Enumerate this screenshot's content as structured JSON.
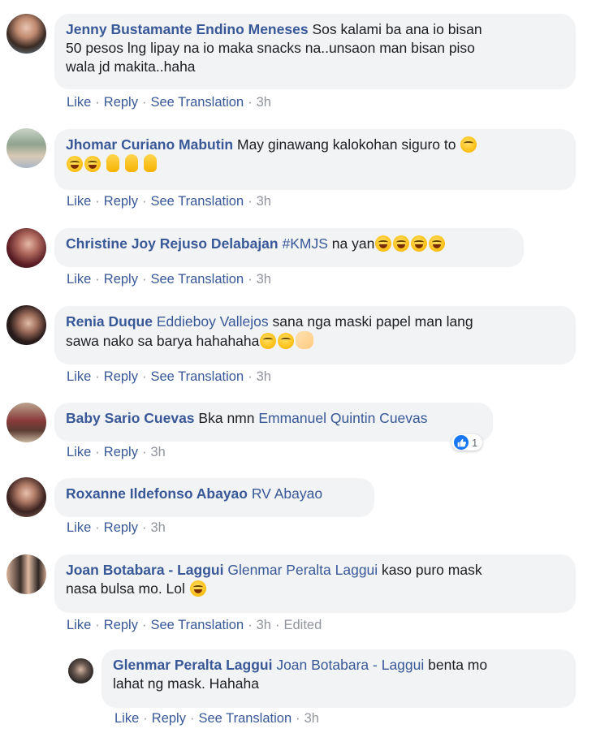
{
  "actions": {
    "like": "Like",
    "reply": "Reply",
    "see_translation": "See Translation",
    "edited": "Edited",
    "separator": "·"
  },
  "comments": [
    {
      "author": "Jenny Bustamante Endino Meneses",
      "text_line1": "Sos kalami ba ana io bisan",
      "text_line2": "50 pesos lng lipay na io maka snacks na..unsaon man bisan piso",
      "text_line3": "wala jd makita..haha",
      "time": "3h"
    },
    {
      "author": "Jhomar Curiano Mabutin",
      "text": "May ginawang kalokohan siguro to",
      "time": "3h"
    },
    {
      "author": "Christine Joy Rejuso Delabajan",
      "mention": "#KMJS",
      "text": "na yan",
      "time": "3h"
    },
    {
      "author": "Renia Duque",
      "mention": "Eddieboy Vallejos",
      "text": "sana nga maski papel man lang",
      "text_line2": "sawa nako sa barya hahahaha",
      "time": "3h"
    },
    {
      "author": "Baby Sario Cuevas",
      "text": "Bka nmn",
      "mention": "Emmanuel Quintin Cuevas",
      "time": "3h",
      "reaction_count": "1"
    },
    {
      "author": "Roxanne Ildefonso Abayao",
      "mention": "RV Abayao",
      "time": "3h"
    },
    {
      "author": "Joan Botabara - Laggui",
      "mention": "Glenmar Peralta Laggui",
      "text": "kaso puro mask",
      "text_line2": "nasa bulsa mo. Lol",
      "time": "3h"
    },
    {
      "author": "Glenmar Peralta Laggui",
      "mention": "Joan Botabara - Laggui",
      "text": "benta mo",
      "text_line2": "lahat ng mask. Hahaha",
      "time": "3h"
    }
  ],
  "colors": {
    "link": "#385898",
    "bubble": "#f2f3f5",
    "muted": "#90949c",
    "like_blue": "#1877f2"
  }
}
